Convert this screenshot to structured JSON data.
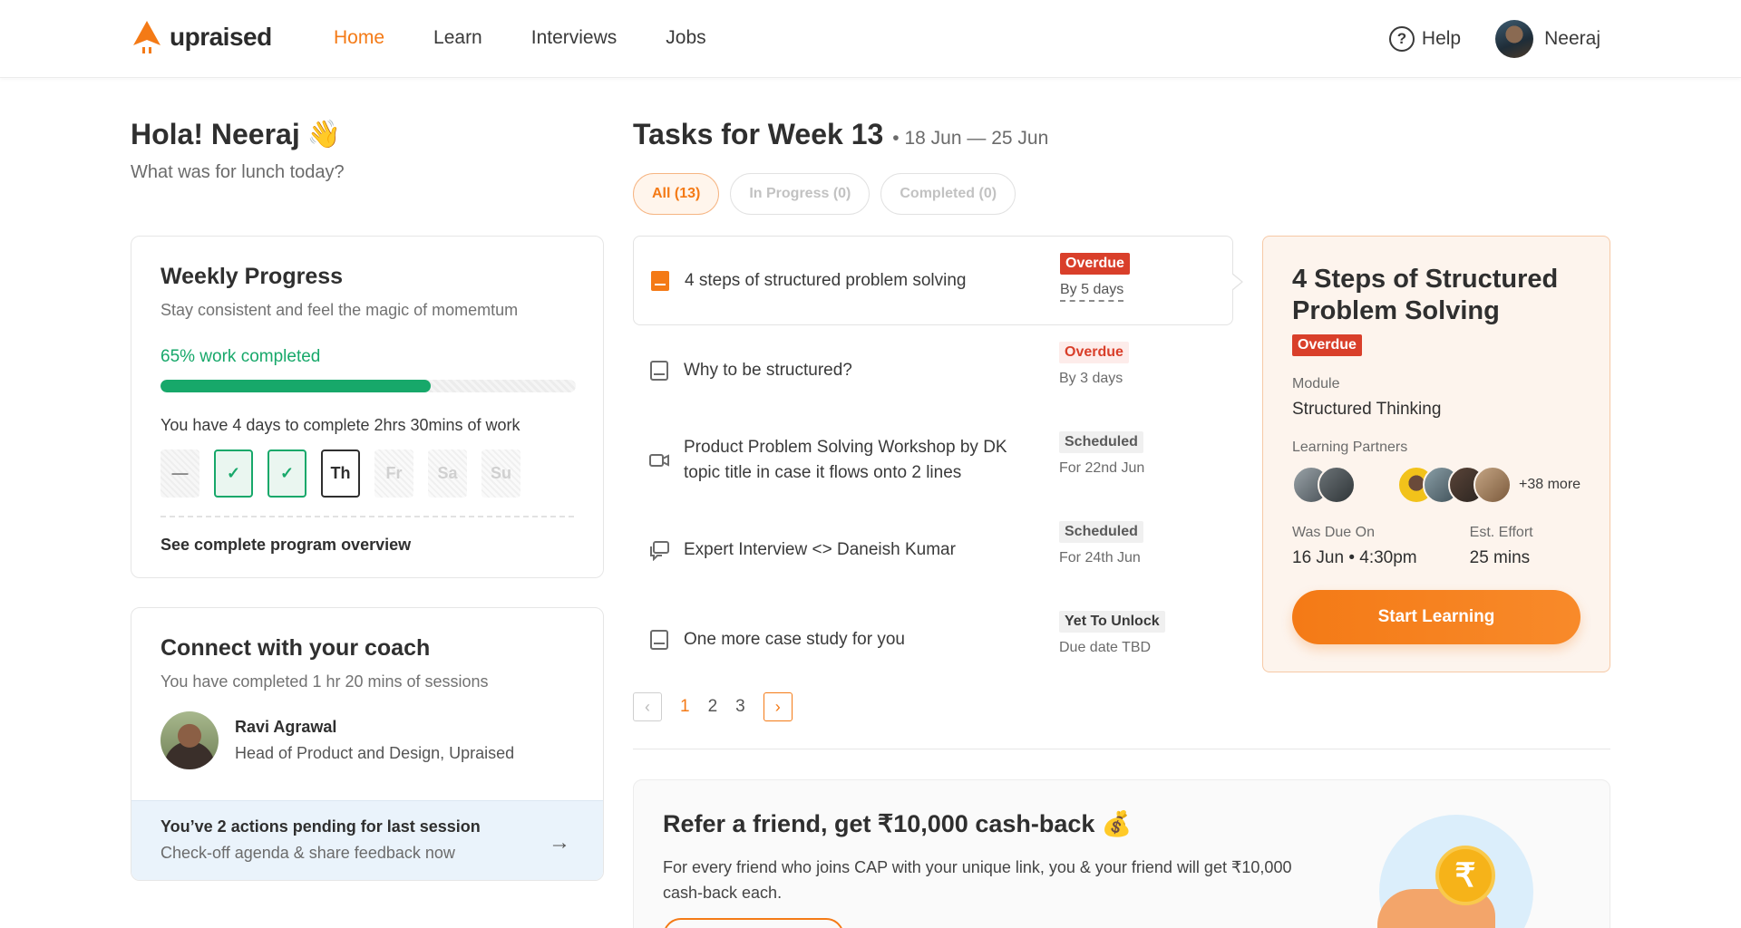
{
  "brand": {
    "name": "upraised",
    "accent": "#f47a16",
    "success": "#17a86a",
    "danger": "#d93f2a"
  },
  "nav": {
    "items": [
      {
        "label": "Home",
        "active": true
      },
      {
        "label": "Learn",
        "active": false
      },
      {
        "label": "Interviews",
        "active": false
      },
      {
        "label": "Jobs",
        "active": false
      }
    ],
    "help_label": "Help",
    "user_name": "Neeraj"
  },
  "greeting": {
    "title": "Hola! Neeraj",
    "emoji": "👋",
    "subtitle": "What was for lunch today?"
  },
  "weekly_progress": {
    "title": "Weekly Progress",
    "subtitle": "Stay consistent and feel the magic of momemtum",
    "progress_label": "65% work completed",
    "progress_value": 0.65,
    "days_left": "You have 4 days to complete 2hrs 30mins of work",
    "days": [
      {
        "label": "—",
        "state": "past"
      },
      {
        "label": "✓",
        "state": "done"
      },
      {
        "label": "✓",
        "state": "done"
      },
      {
        "label": "Th",
        "state": "today"
      },
      {
        "label": "Fr",
        "state": "future"
      },
      {
        "label": "Sa",
        "state": "future"
      },
      {
        "label": "Su",
        "state": "future"
      }
    ],
    "link_label": "See complete program overview"
  },
  "coach": {
    "title": "Connect with your coach",
    "subtitle": "You have completed 1 hr 20 mins of sessions",
    "name": "Ravi Agrawal",
    "role": "Head of Product and Design, Upraised",
    "pending_title": "You’ve 2 actions pending for last session",
    "pending_sub": "Check-off agenda & share feedback now",
    "arrow": "→"
  },
  "tasks": {
    "title": "Tasks for Week 13",
    "range": "• 18 Jun — 25 Jun",
    "filters": [
      {
        "label": "All (13)",
        "active": true
      },
      {
        "label": "In Progress (0)",
        "active": false
      },
      {
        "label": "Completed (0)",
        "active": false
      }
    ],
    "items": [
      {
        "title": "4 steps of structured problem solving",
        "icon": "book-filled-icon",
        "badge": "Overdue",
        "badge_kind": "overdue-solid",
        "due": "By 5 days",
        "selected": true
      },
      {
        "title": "Why to be structured?",
        "icon": "book-icon",
        "badge": "Overdue",
        "badge_kind": "overdue",
        "due": "By 3 days",
        "selected": false
      },
      {
        "title": "Product Problem Solving Workshop by DK topic title in case it flows onto 2 lines",
        "icon": "video-icon",
        "badge": "Scheduled",
        "badge_kind": "scheduled",
        "due": "For 22nd Jun",
        "selected": false
      },
      {
        "title": "Expert Interview <> Daneish Kumar",
        "icon": "chat-icon",
        "badge": "Scheduled",
        "badge_kind": "scheduled",
        "due": "For 24th Jun",
        "selected": false
      },
      {
        "title": "One more case study for you",
        "icon": "book-icon",
        "badge": "Yet To Unlock",
        "badge_kind": "locked",
        "due": "Due date TBD",
        "selected": false
      }
    ],
    "pagination": {
      "prev": "‹",
      "next": "›",
      "pages": [
        "1",
        "2",
        "3"
      ],
      "current": "1"
    }
  },
  "detail": {
    "title": "4 Steps of Structured Problem Solving",
    "badge": "Overdue",
    "module_label": "Module",
    "module_value": "Structured Thinking",
    "partners_label": "Learning Partners",
    "partners_more": "+38 more",
    "due_label": "Was Due On",
    "due_value": "16 Jun • 4:30pm",
    "effort_label": "Est. Effort",
    "effort_value": "25 mins",
    "cta": "Start Learning"
  },
  "refer": {
    "title": "Refer a friend, get ₹10,000 cash-back",
    "emoji": "💰",
    "body": "For every friend who joins CAP with your unique link, you & your friend will get ₹10,000 cash-back each.",
    "coin_symbol": "₹"
  }
}
